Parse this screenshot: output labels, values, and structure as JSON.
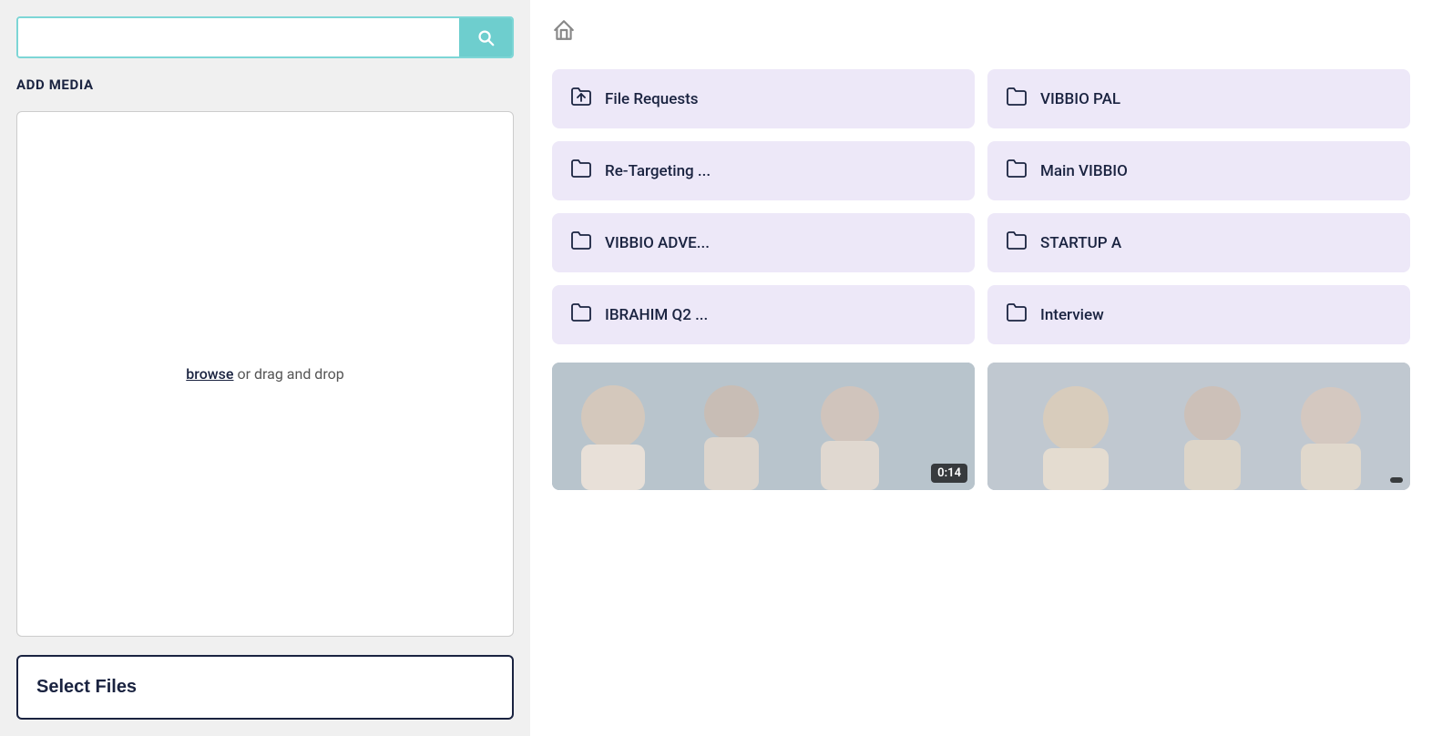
{
  "left": {
    "search": {
      "placeholder": "",
      "button_icon": "search-icon"
    },
    "add_media_label": "ADD MEDIA",
    "dropzone": {
      "browse_text": "browse",
      "rest_text": " or drag and drop"
    },
    "select_files_label": "Select Files"
  },
  "right": {
    "breadcrumb": {
      "home_icon": "home-icon"
    },
    "folders": [
      {
        "name": "File Requests",
        "icon": "folder-upload-icon"
      },
      {
        "name": "VIBBIO PAL",
        "icon": "folder-icon"
      },
      {
        "name": "Re-Targeting ...",
        "icon": "folder-icon"
      },
      {
        "name": "Main VIBBIO",
        "icon": "folder-icon"
      },
      {
        "name": "VIBBIO ADVE...",
        "icon": "folder-icon"
      },
      {
        "name": "STARTUP A",
        "icon": "folder-icon"
      },
      {
        "name": "IBRAHIM Q2 ...",
        "icon": "folder-icon"
      },
      {
        "name": "Interview",
        "icon": "folder-icon"
      }
    ],
    "videos": [
      {
        "duration": "0:14"
      },
      {
        "duration": ""
      }
    ]
  }
}
